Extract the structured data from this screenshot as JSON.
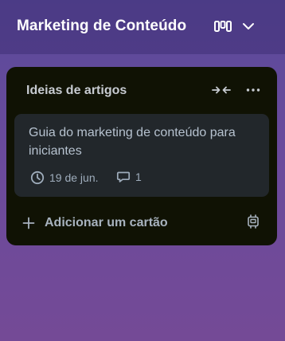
{
  "board": {
    "title": "Marketing de Conteúdo",
    "icons": [
      "board-view-icon",
      "chevron-down-icon"
    ]
  },
  "list": {
    "title": "Ideias de artigos",
    "icons": [
      "collapse-icon",
      "more-icon"
    ],
    "cards": [
      {
        "title": "Guia do marketing de conteúdo para iniciantes",
        "due_date": "19 de jun.",
        "comments": "1",
        "icons": [
          "clock-icon",
          "comment-icon"
        ]
      }
    ],
    "add_card_label": "Adicionar um cartão",
    "add_icons": [
      "plus-icon",
      "template-icon"
    ]
  },
  "colors": {
    "list_background": "#101204",
    "card_background": "#22272b",
    "text": "#b6c2cf"
  }
}
